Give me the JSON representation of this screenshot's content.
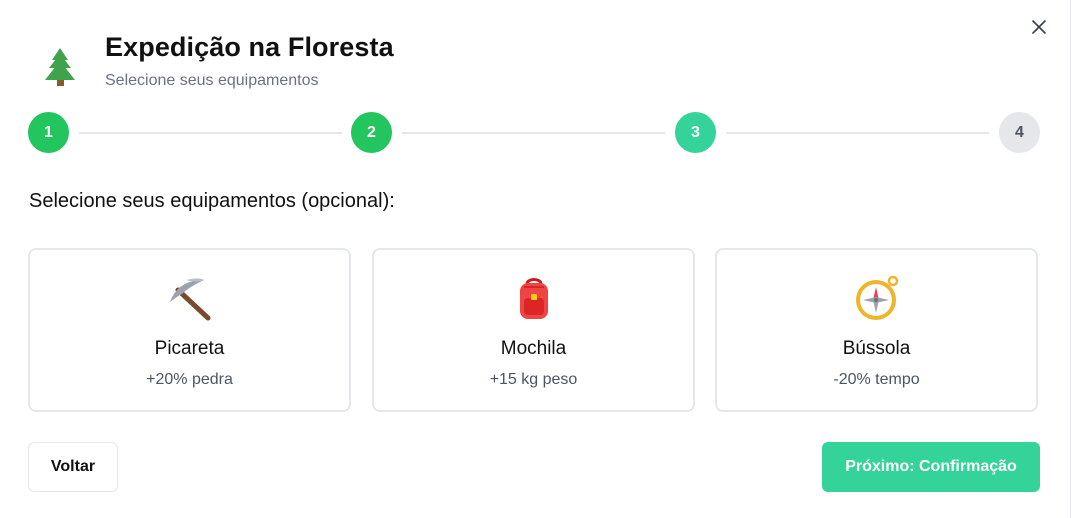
{
  "header": {
    "title": "Expedição na Floresta",
    "subtitle": "Selecione seus equipamentos",
    "icon": "tree-icon"
  },
  "close": {
    "icon": "close-icon"
  },
  "stepper": {
    "current_step": 3,
    "steps": [
      {
        "label": "1",
        "state": "completed"
      },
      {
        "label": "2",
        "state": "completed"
      },
      {
        "label": "3",
        "state": "active"
      },
      {
        "label": "4",
        "state": "pending"
      }
    ]
  },
  "section": {
    "heading": "Selecione seus equipamentos (opcional):"
  },
  "equipment": [
    {
      "name": "Picareta",
      "bonus": "+20% pedra",
      "icon": "pickaxe-icon"
    },
    {
      "name": "Mochila",
      "bonus": "+15 kg peso",
      "icon": "backpack-icon"
    },
    {
      "name": "Bússola",
      "bonus": "-20% tempo",
      "icon": "compass-icon"
    }
  ],
  "footer": {
    "back_label": "Voltar",
    "next_label": "Próximo: Confirmação"
  },
  "colors": {
    "step_completed": "#22c55e",
    "step_active": "#34d399",
    "step_pending_bg": "#e5e7eb",
    "step_pending_text": "#4b5563",
    "primary_button": "#34d399"
  }
}
